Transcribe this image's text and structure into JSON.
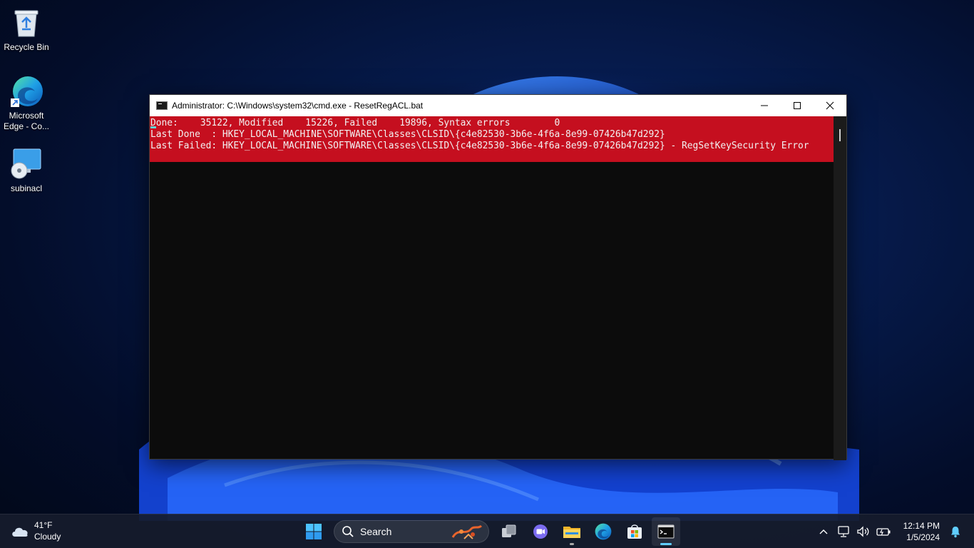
{
  "desktop": {
    "icons": [
      {
        "label": "Recycle Bin"
      },
      {
        "label": "Microsoft\nEdge - Co..."
      },
      {
        "label": "subinacl"
      }
    ]
  },
  "cmd": {
    "title": "Administrator: C:\\Windows\\system32\\cmd.exe - ResetRegACL.bat",
    "lines": [
      "Done:    35122, Modified    15226, Failed    19896, Syntax errors        0",
      "Last Done  : HKEY_LOCAL_MACHINE\\SOFTWARE\\Classes\\CLSID\\{c4e82530-3b6e-4f6a-8e99-07426b47d292}",
      "Last Failed: HKEY_LOCAL_MACHINE\\SOFTWARE\\Classes\\CLSID\\{c4e82530-3b6e-4f6a-8e99-07426b47d292} - RegSetKeySecurity Error"
    ],
    "band_color": "#c50f1f",
    "background_color": "#0c0c0c"
  },
  "taskbar": {
    "weather": {
      "temp": "41°F",
      "condition": "Cloudy",
      "icon": "cloud-icon"
    },
    "search_label": "Search",
    "apps": [
      "file-explorer-icon",
      "edge-icon",
      "store-icon",
      "terminal-icon"
    ],
    "clock": {
      "time": "12:14 PM",
      "date": "1/5/2024"
    },
    "accent": "#60cdff"
  }
}
